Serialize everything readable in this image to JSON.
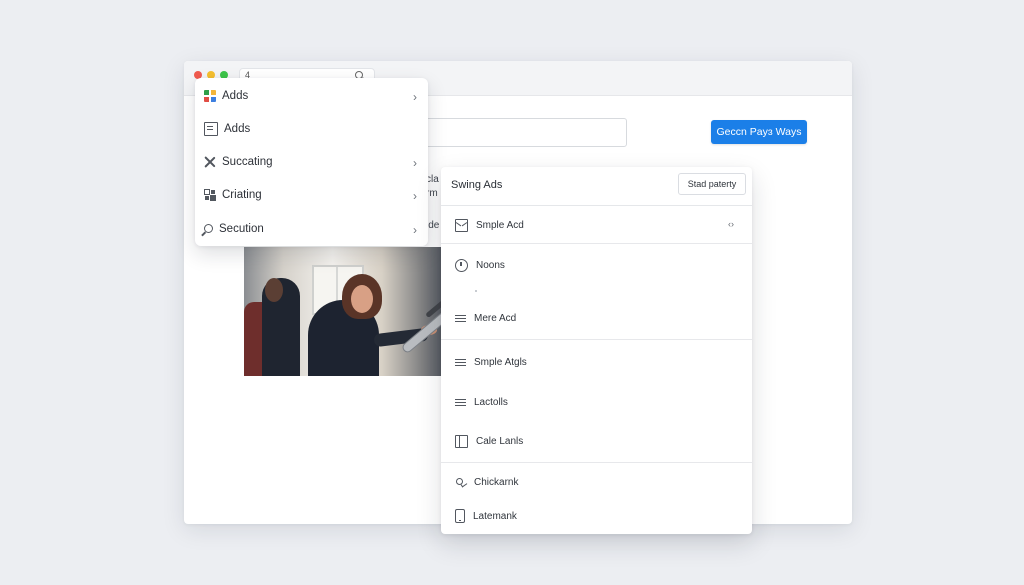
{
  "window": {
    "controls": [
      "close",
      "minimize",
      "maximize"
    ],
    "tab_glyph": "4",
    "search_icon": "search-icon"
  },
  "main": {
    "primary_button_label": "Geccn Payɜ Ways",
    "snippets": [
      "cla",
      "rm",
      "ide"
    ]
  },
  "left_menu": {
    "items": [
      {
        "label": "Adds",
        "icon": "app-grid-icon",
        "has_submenu": true
      },
      {
        "label": "Adds",
        "icon": "book-icon",
        "has_submenu": false
      },
      {
        "label": "Succating",
        "icon": "close-icon",
        "has_submenu": true
      },
      {
        "label": "Criating",
        "icon": "grid-icon",
        "has_submenu": true
      },
      {
        "label": "Secution",
        "icon": "search-icon",
        "has_submenu": true
      }
    ]
  },
  "right_panel": {
    "title": "Swing Ads",
    "action_button_label": "Stad paterty",
    "items": [
      {
        "label": "Smple Acd",
        "icon": "mail-icon",
        "trailing": "‹›"
      },
      {
        "label": "Noons",
        "icon": "circle-icon"
      },
      {
        "label": "Mere Acd",
        "icon": "lines-icon"
      },
      {
        "label": "Smple Atgls",
        "icon": "lines-icon"
      },
      {
        "label": "Lactolls",
        "icon": "lines-icon"
      },
      {
        "label": "Cale Lanls",
        "icon": "sidebar-icon"
      },
      {
        "label": "Chickarnk",
        "icon": "check-icon"
      },
      {
        "label": "Latemank",
        "icon": "phone-icon"
      }
    ]
  },
  "colors": {
    "primary": "#1b7fe8",
    "background": "#eceef2",
    "surface": "#ffffff"
  }
}
